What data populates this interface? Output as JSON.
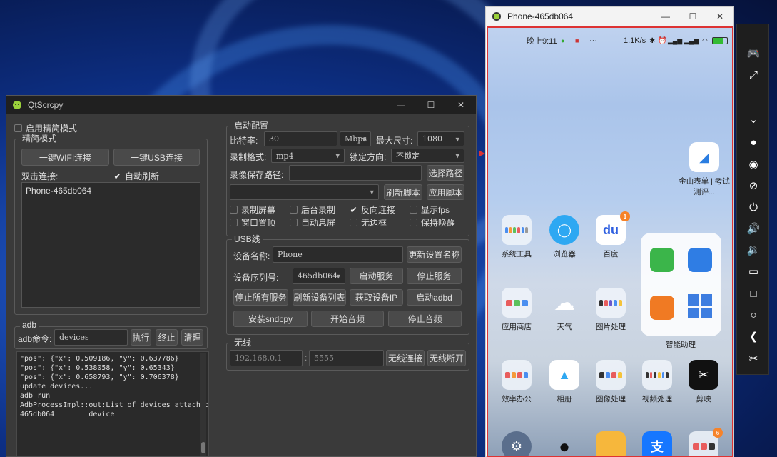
{
  "qtscrcpy": {
    "title": "QtScrcpy",
    "simple_mode_checkbox": "启用精简模式",
    "simple_group": "精简模式",
    "wifi_button": "一键WIFI连接",
    "usb_button": "一键USB连接",
    "double_click_label": "双击连接:",
    "auto_refresh": "自动刷新",
    "device_list": [
      "Phone-465db064"
    ],
    "start_config": {
      "legend": "启动配置",
      "bitrate_label": "比特率:",
      "bitrate_value": "30",
      "bitrate_unit": "Mbps",
      "max_size_label": "最大尺寸:",
      "max_size_value": "1080",
      "record_format_label": "录制格式:",
      "record_format_value": "mp4",
      "lock_direction_label": "锁定方向:",
      "lock_direction_value": "不锁定",
      "record_path_label": "录像保存路径:",
      "record_path_value": "",
      "select_path_button": "选择路径",
      "script_value": "",
      "refresh_script_button": "刷新脚本",
      "apply_script_button": "应用脚本",
      "options": [
        {
          "label": "录制屏幕",
          "checked": false
        },
        {
          "label": "后台录制",
          "checked": false
        },
        {
          "label": "反向连接",
          "checked": true
        },
        {
          "label": "显示fps",
          "checked": false
        },
        {
          "label": "窗口置顶",
          "checked": false
        },
        {
          "label": "自动息屏",
          "checked": false
        },
        {
          "label": "无边框",
          "checked": false
        },
        {
          "label": "保持唤醒",
          "checked": false
        }
      ]
    },
    "usb": {
      "legend": "USB线",
      "device_name_label": "设备名称:",
      "device_name_value": "Phone",
      "update_name_button": "更新设置名称",
      "serial_label": "设备序列号:",
      "serial_value": "465db064",
      "start_service_button": "启动服务",
      "stop_service_button": "停止服务",
      "stop_all_button": "停止所有服务",
      "refresh_devices_button": "刷新设备列表",
      "get_ip_button": "获取设备IP",
      "start_adbd_button": "启动adbd",
      "install_button": "安装sndcpy",
      "start_audio_button": "开始音频",
      "stop_audio_button": "停止音频"
    },
    "wireless": {
      "legend": "无线",
      "ip_placeholder": "192.168.0.1",
      "port_placeholder": "5555",
      "connect_button": "无线连接",
      "disconnect_button": "无线断开"
    },
    "adb": {
      "legend": "adb",
      "command_label": "adb命令:",
      "command_value": "devices",
      "execute_button": "执行",
      "terminate_button": "终止",
      "clear_button": "清理"
    },
    "log_lines": [
      "\"pos\": {\"x\": 0.509186, \"y\": 0.637786}",
      "",
      "\"pos\": {\"x\": 0.538058, \"y\": 0.65343}",
      "",
      "\"pos\": {\"x\": 0.658793, \"y\": 0.706378}",
      "",
      "update devices...",
      "adb run",
      "AdbProcessImpl::out:List of devices attached",
      "465db064\tdevice"
    ]
  },
  "phone": {
    "title": "Phone-465db064",
    "status_time": "晚上9:11",
    "status_speed": "1.1K/s",
    "apps": [
      {
        "label": "金山表单 | 考试测评..."
      },
      {
        "label": "系统工具"
      },
      {
        "label": "浏览器"
      },
      {
        "label": "百度",
        "badge": "1"
      },
      {
        "label": "智能助理"
      },
      {
        "label": "应用商店"
      },
      {
        "label": "天气"
      },
      {
        "label": "图片处理"
      },
      {
        "label": "效率办公"
      },
      {
        "label": "相册"
      },
      {
        "label": "图像处理"
      },
      {
        "label": "视频处理"
      },
      {
        "label": "剪映"
      },
      {
        "label": "",
        "badge": "6"
      }
    ]
  },
  "toolbar": {
    "icons": [
      "gamepad-icon",
      "fullscreen-icon",
      "collapse-icon",
      "record-icon",
      "eye-icon",
      "eye-off-icon",
      "power-icon",
      "volume-up-icon",
      "volume-down-icon",
      "app-switch-icon",
      "home-icon",
      "back-icon",
      "cut-icon"
    ]
  },
  "colors": {
    "accent_red": "#dd3333",
    "window_dark": "#3a3a3a"
  }
}
